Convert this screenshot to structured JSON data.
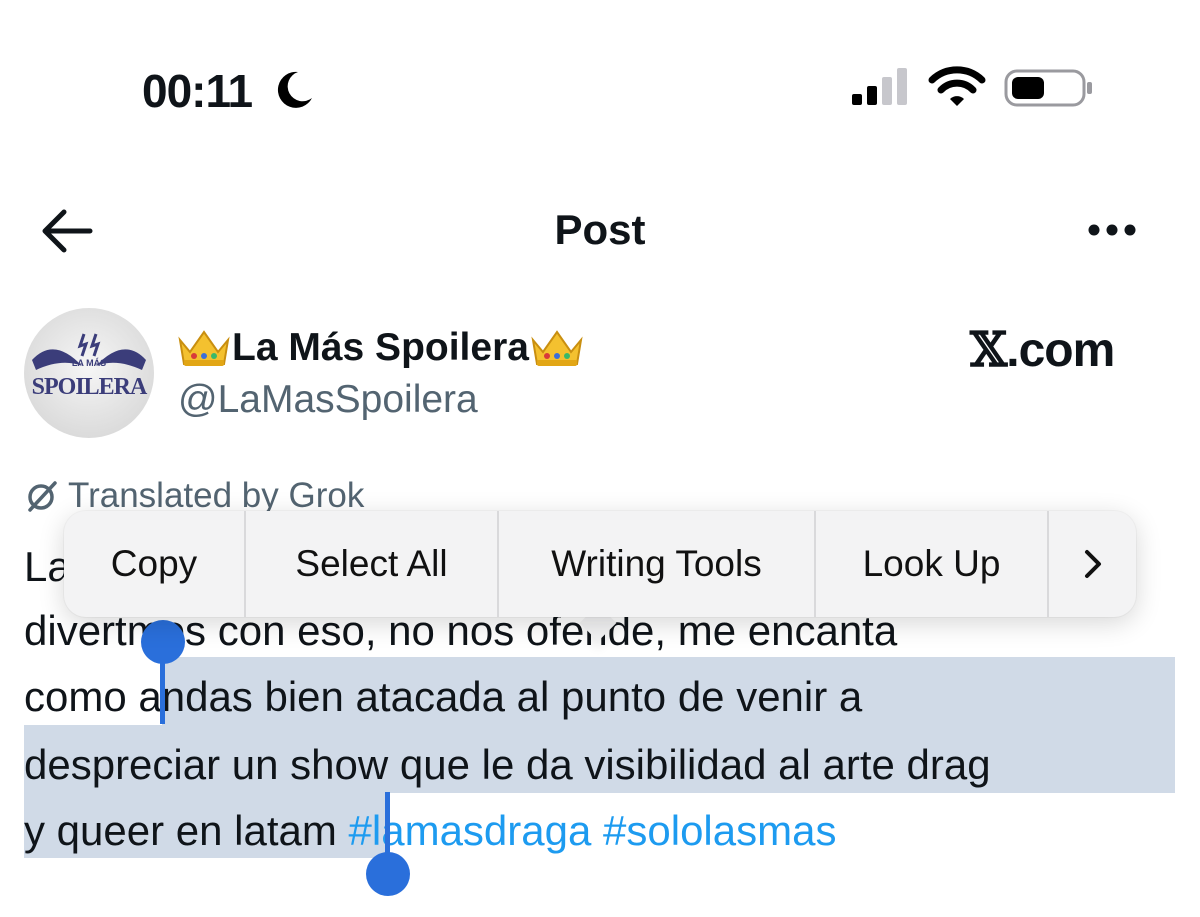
{
  "status_bar": {
    "time": "00:11"
  },
  "header": {
    "title": "Post"
  },
  "author": {
    "name": "La Más Spoilera",
    "handle": "@LaMasSpoilera",
    "avatar_text_top": "LA MÁS",
    "avatar_text_bottom": "SPOILERA"
  },
  "brand": {
    "x": "𝕏",
    "domain": ".com"
  },
  "translation": {
    "label": "Translated by Grok"
  },
  "post": {
    "line1_start": "La",
    "line2_start": "divert",
    "line2_mid": "mos con eso, no nos ofende, me encanta",
    "line3_plain": "como ",
    "line3_selected": "andas bien atacada al punto de venir a",
    "line4": "despreciar un show que le da visibilidad al arte drag",
    "line5_selected": "y queer en latam",
    "hashtags": [
      "#lamasdraga",
      "#sololasmas"
    ]
  },
  "context_menu": {
    "items": [
      "Copy",
      "Select All",
      "Writing Tools",
      "Look Up"
    ],
    "more_icon": "chevron-right-icon"
  },
  "colors": {
    "selection": "#d0dae7",
    "caret": "#2a6fdb",
    "hashtag": "#1d9bf0",
    "secondary_text": "#536471"
  }
}
